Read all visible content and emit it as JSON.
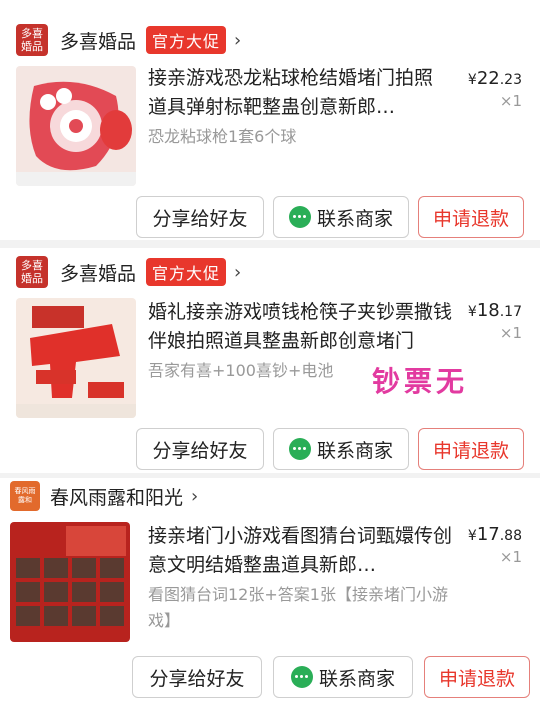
{
  "orders": [
    {
      "shop": {
        "logo_text": "多喜婚品",
        "name": "多喜婚品",
        "badge": "官方大促",
        "chevron": "›"
      },
      "title": "接亲游戏恐龙粘球枪结婚堵门拍照道具弹射标靶整蛊创意新郎…",
      "spec": "恐龙粘球枪1套6个球",
      "price": {
        "symbol": "¥",
        "int": "22",
        "dec": ".23"
      },
      "qty": "×1",
      "buttons": {
        "share": "分享给好友",
        "contact": "联系商家",
        "refund": "申请退款"
      }
    },
    {
      "shop": {
        "logo_text": "多喜婚品",
        "name": "多喜婚品",
        "badge": "官方大促",
        "chevron": "›"
      },
      "title": "婚礼接亲游戏喷钱枪筷子夹钞票撒钱伴娘拍照道具整蛊新郎创意堵门",
      "spec": "吾家有喜+100喜钞+电池",
      "price": {
        "symbol": "¥",
        "int": "18",
        "dec": ".17"
      },
      "qty": "×1",
      "buttons": {
        "share": "分享给好友",
        "contact": "联系商家",
        "refund": "申请退款"
      }
    },
    {
      "shop": {
        "logo_text": "春风雨露和",
        "name": "春风雨露和阳光",
        "chevron": "›"
      },
      "title": "接亲堵门小游戏看图猜台词甄嬛传创意文明结婚整蛊道具新郎…",
      "spec": "看图猜台词12张+答案1张【接亲堵门小游戏】",
      "price": {
        "symbol": "¥",
        "int": "17",
        "dec": ".88"
      },
      "qty": "×1",
      "buttons": {
        "share": "分享给好友",
        "contact": "联系商家",
        "refund": "申请退款"
      }
    }
  ],
  "overlay_text": "钞票无",
  "colors": {
    "accent": "#e8372c",
    "background": "#f2f2f2",
    "wechat_green": "#2aae57"
  }
}
